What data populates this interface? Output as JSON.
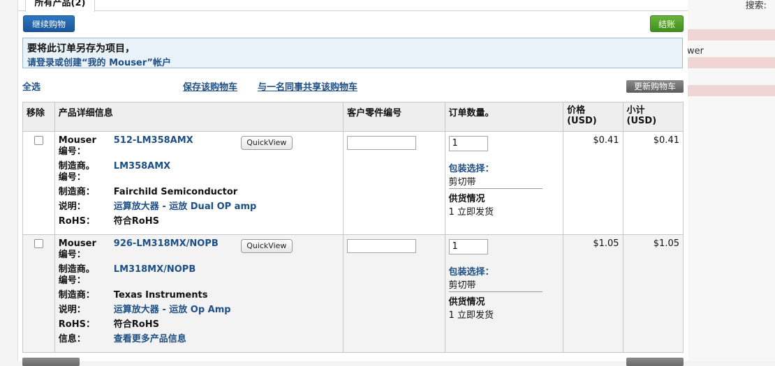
{
  "tab": {
    "label": "所有产品(2)"
  },
  "buttons": {
    "continue_shopping": "继续购物",
    "checkout": "结账",
    "update_cart": "更新购物车"
  },
  "save_box": {
    "line1": "要将此订单另存为项目，",
    "line2": "请登录或创建“我的 Mouser”帐户"
  },
  "links": {
    "select_all": "全选",
    "save_cart": "保存该购物车",
    "share_cart": "与一名同事共享该购物车"
  },
  "right_panel": {
    "search_label": "搜索:",
    "partial_text": "wer"
  },
  "table": {
    "headers": {
      "remove": "移除",
      "details": "产品详细信息",
      "customer_part": "客户零件编号",
      "quantity": "订单数量。",
      "price": "价格\n(USD)",
      "subtotal": "小计\n(USD)"
    },
    "labels": {
      "mouser_no": "Mouser\n编号：",
      "mfr_no": "制造商。\n编号：",
      "mfr": "制造商：",
      "desc": "说明：",
      "rohs": "RoHS：",
      "info": "信息："
    },
    "quickview": "QuickView",
    "packaging_label": "包装选择：",
    "availability_label": "供货情况",
    "rows": [
      {
        "mouser_no": "512-LM358AMX",
        "mfr_no": "LM358AMX",
        "mfr": "Fairchild Semiconductor",
        "desc": "运算放大器 - 运放 Dual OP amp",
        "rohs": "符合RoHS",
        "qty": "1",
        "packaging": "剪切带",
        "availability": "1 立即发货",
        "price": "$0.41",
        "subtotal": "$0.41"
      },
      {
        "mouser_no": "926-LM318MX/NOPB",
        "mfr_no": "LM318MX/NOPB",
        "mfr": "Texas Instruments",
        "desc": "运算放大器 - 运放 Op Amp",
        "rohs": "符合RoHS",
        "info": "查看更多产品信息",
        "qty": "1",
        "packaging": "剪切带",
        "availability": "1 立即发货",
        "price": "$1.05",
        "subtotal": "$1.05"
      }
    ]
  }
}
